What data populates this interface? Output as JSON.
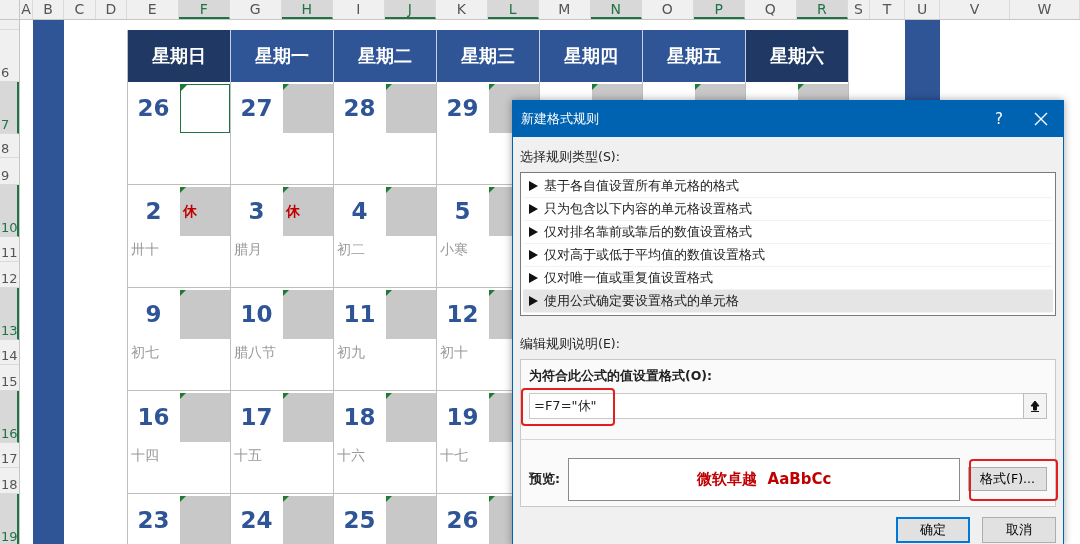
{
  "sheet": {
    "column_headers": [
      {
        "label": "A",
        "selected": false
      },
      {
        "label": "B",
        "selected": false
      },
      {
        "label": "C",
        "selected": false
      },
      {
        "label": "D",
        "selected": false
      },
      {
        "label": "E",
        "selected": false
      },
      {
        "label": "F",
        "selected": true
      },
      {
        "label": "G",
        "selected": false
      },
      {
        "label": "H",
        "selected": true
      },
      {
        "label": "I",
        "selected": false
      },
      {
        "label": "J",
        "selected": true
      },
      {
        "label": "K",
        "selected": false
      },
      {
        "label": "L",
        "selected": true
      },
      {
        "label": "M",
        "selected": false
      },
      {
        "label": "N",
        "selected": true
      },
      {
        "label": "O",
        "selected": false
      },
      {
        "label": "P",
        "selected": true
      },
      {
        "label": "Q",
        "selected": false
      },
      {
        "label": "R",
        "selected": true
      },
      {
        "label": "S",
        "selected": false
      },
      {
        "label": "T",
        "selected": false
      },
      {
        "label": "U",
        "selected": false
      },
      {
        "label": "V",
        "selected": false
      },
      {
        "label": "W",
        "selected": false
      }
    ],
    "row_headers": [
      {
        "label": "6",
        "selected": false
      },
      {
        "label": "7",
        "selected": true
      },
      {
        "label": "8",
        "selected": false
      },
      {
        "label": "9",
        "selected": false
      },
      {
        "label": "10",
        "selected": true
      },
      {
        "label": "11",
        "selected": false
      },
      {
        "label": "12",
        "selected": false
      },
      {
        "label": "13",
        "selected": true
      },
      {
        "label": "14",
        "selected": false
      },
      {
        "label": "15",
        "selected": false
      },
      {
        "label": "16",
        "selected": true
      },
      {
        "label": "17",
        "selected": false
      },
      {
        "label": "18",
        "selected": false
      },
      {
        "label": "19",
        "selected": true
      }
    ]
  },
  "calendar": {
    "weekdays": [
      {
        "label": "星期日",
        "weekend": true
      },
      {
        "label": "星期一",
        "weekend": false
      },
      {
        "label": "星期二",
        "weekend": false
      },
      {
        "label": "星期三",
        "weekend": false
      },
      {
        "label": "星期四",
        "weekend": false
      },
      {
        "label": "星期五",
        "weekend": false
      },
      {
        "label": "星期六",
        "weekend": true
      }
    ],
    "weeks": [
      {
        "days": [
          {
            "number": "26",
            "selected": true
          },
          {
            "number": "27",
            "selected": false
          },
          {
            "number": "28",
            "selected": false
          },
          {
            "number": "29",
            "selected": false
          }
        ]
      },
      {
        "days": [
          {
            "number": "2",
            "mark": "休",
            "lunar": "卅十",
            "selected": false
          },
          {
            "number": "3",
            "mark": "休",
            "lunar": "腊月",
            "selected": false
          },
          {
            "number": "4",
            "lunar": "初二",
            "selected": false
          },
          {
            "number": "5",
            "lunar": "小寒",
            "selected": false
          }
        ]
      },
      {
        "days": [
          {
            "number": "9",
            "lunar": "初七",
            "selected": false
          },
          {
            "number": "10",
            "lunar": "腊八节",
            "selected": false
          },
          {
            "number": "11",
            "lunar": "初九",
            "selected": false
          },
          {
            "number": "12",
            "lunar": "初十",
            "selected": false
          }
        ]
      },
      {
        "days": [
          {
            "number": "16",
            "lunar": "十四",
            "selected": false
          },
          {
            "number": "17",
            "lunar": "十五",
            "selected": false
          },
          {
            "number": "18",
            "lunar": "十六",
            "selected": false
          },
          {
            "number": "19",
            "lunar": "十七",
            "selected": false
          }
        ]
      },
      {
        "days": [
          {
            "number": "23",
            "selected": false
          },
          {
            "number": "24",
            "selected": false
          },
          {
            "number": "25",
            "selected": false
          },
          {
            "number": "26",
            "selected": false
          }
        ]
      }
    ]
  },
  "dialog": {
    "title": "新建格式规则",
    "help": "?",
    "rule_type_label": "选择规则类型(S):",
    "rule_types": [
      {
        "label": "基于各自值设置所有单元格的格式",
        "selected": false
      },
      {
        "label": "只为包含以下内容的单元格设置格式",
        "selected": false
      },
      {
        "label": "仅对排名靠前或靠后的数值设置格式",
        "selected": false
      },
      {
        "label": "仅对高于或低于平均值的数值设置格式",
        "selected": false
      },
      {
        "label": "仅对唯一值或重复值设置格式",
        "selected": false
      },
      {
        "label": "使用公式确定要设置格式的单元格",
        "selected": true
      }
    ],
    "edit_label": "编辑规则说明(E):",
    "formula_label": "为符合此公式的值设置格式(O):",
    "formula_value": "=F7=\"休\"",
    "preview_label": "预览:",
    "preview_text": "微软卓越  AaBbCc",
    "format_button": "格式(F)...",
    "buttons": [
      {
        "label": "确定",
        "default": true
      },
      {
        "label": "取消",
        "default": false
      }
    ]
  }
}
